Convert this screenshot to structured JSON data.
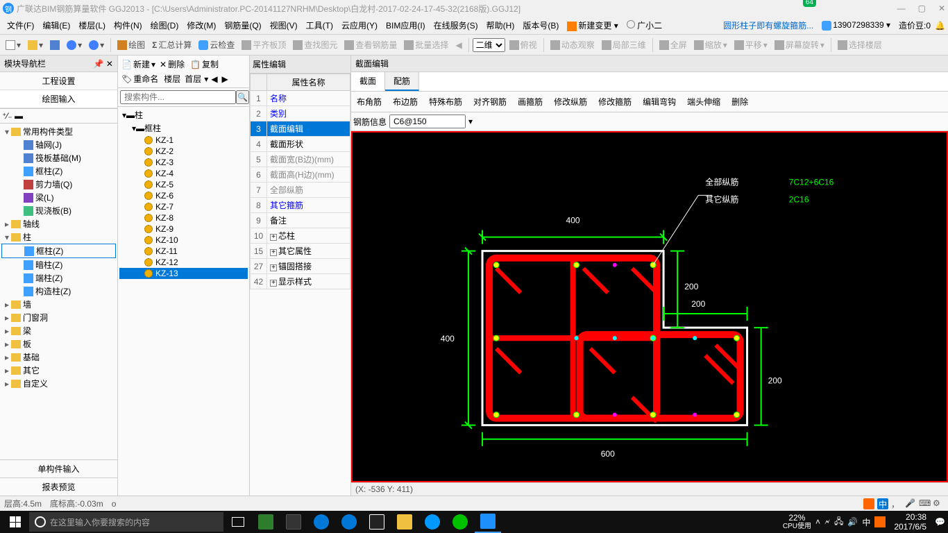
{
  "title": "广联达BIM钢筋算量软件 GGJ2013 - [C:\\Users\\Administrator.PC-20141127NRHM\\Desktop\\白龙村-2017-02-24-17-45-32(2168版).GGJ12]",
  "badge": "64",
  "menus": [
    "文件(F)",
    "编辑(E)",
    "楼层(L)",
    "构件(N)",
    "绘图(D)",
    "修改(M)",
    "钢筋量(Q)",
    "视图(V)",
    "工具(T)",
    "云应用(Y)",
    "BIM应用(I)",
    "在线服务(S)",
    "帮助(H)",
    "版本号(B)"
  ],
  "menu_right": {
    "new_change": "新建变更",
    "user": "广小二",
    "link": "圆形柱子即有螺旋箍筋...",
    "phone": "13907298339",
    "cost": "造价豆:0"
  },
  "toolbar": {
    "draw": "绘图",
    "sum": "汇总计算",
    "cloud": "云检查",
    "flat": "平齐板顶",
    "find": "查找图元",
    "steel": "查看钢筋量",
    "batch": "批量选择",
    "mode": "二维",
    "view": "俯视",
    "dyn": "动态观察",
    "local3d": "局部三维",
    "full": "全屏",
    "zoom": "缩放",
    "pan": "平移",
    "rot": "屏幕旋转",
    "floor": "选择楼层"
  },
  "left": {
    "title": "模块导航栏",
    "tab1": "工程设置",
    "tab2": "绘图输入",
    "groups": {
      "common": "常用构件类型",
      "grid": "轴网(J)",
      "raft": "筏板基础(M)",
      "fcol": "框柱(Z)",
      "shear": "剪力墙(Q)",
      "beam": "梁(L)",
      "slab": "现浇板(B)",
      "axis": "轴线",
      "col": "柱",
      "fcol2": "框柱(Z)",
      "dcol": "暗柱(Z)",
      "ecol": "端柱(Z)",
      "ccol": "构造柱(Z)",
      "wall": "墙",
      "door": "门窗洞",
      "beam2": "梁",
      "slab2": "板",
      "found": "基础",
      "other": "其它",
      "custom": "自定义"
    },
    "bottom1": "单构件输入",
    "bottom2": "报表预览"
  },
  "comp": {
    "toolbar": {
      "new": "新建",
      "del": "删除",
      "copy": "复制",
      "rename": "重命名",
      "floor": "楼层",
      "first": "首层"
    },
    "search_ph": "搜索构件...",
    "root": "柱",
    "group": "框柱",
    "items": [
      "KZ-1",
      "KZ-2",
      "KZ-3",
      "KZ-4",
      "KZ-5",
      "KZ-6",
      "KZ-7",
      "KZ-8",
      "KZ-9",
      "KZ-10",
      "KZ-11",
      "KZ-12",
      "KZ-13"
    ],
    "selected": "KZ-13"
  },
  "prop": {
    "title": "属性编辑",
    "header": "属性名称",
    "rows": [
      {
        "n": "1",
        "name": "名称",
        "cls": "blue"
      },
      {
        "n": "2",
        "name": "类别",
        "cls": "blue"
      },
      {
        "n": "3",
        "name": "截面编辑",
        "cls": "sel"
      },
      {
        "n": "4",
        "name": "截面形状",
        "cls": ""
      },
      {
        "n": "5",
        "name": "截面宽(B边)(mm)",
        "cls": "grey"
      },
      {
        "n": "6",
        "name": "截面高(H边)(mm)",
        "cls": "grey"
      },
      {
        "n": "7",
        "name": "全部纵筋",
        "cls": "grey"
      },
      {
        "n": "8",
        "name": "其它箍筋",
        "cls": "blue"
      },
      {
        "n": "9",
        "name": "备注",
        "cls": ""
      },
      {
        "n": "10",
        "name": "芯柱",
        "cls": "",
        "plus": true
      },
      {
        "n": "15",
        "name": "其它属性",
        "cls": "",
        "plus": true
      },
      {
        "n": "27",
        "name": "锚固搭接",
        "cls": "",
        "plus": true
      },
      {
        "n": "42",
        "name": "显示样式",
        "cls": "",
        "plus": true
      }
    ]
  },
  "section": {
    "title": "截面编辑",
    "tabs": [
      "截面",
      "配筋"
    ],
    "active_tab": 1,
    "tools": [
      "布角筋",
      "布边筋",
      "特殊布筋",
      "对齐钢筋",
      "画箍筋",
      "修改纵筋",
      "修改箍筋",
      "编辑弯钩",
      "端头伸缩",
      "删除"
    ],
    "rebar_label": "钢筋信息",
    "rebar_value": "C6@150",
    "labels": {
      "all": "全部纵筋",
      "other": "其它纵筋",
      "all_v": "7C12+6C16",
      "other_v": "2C16"
    },
    "dims": {
      "top": "400",
      "left": "400",
      "r1": "200",
      "r2": "200",
      "r3": "200",
      "bottom": "600"
    },
    "coord": "(X: -536 Y: 411)"
  },
  "status": {
    "floor": "层高:4.5m",
    "bottom": "底标高:-0.03m",
    "unit": "o"
  },
  "taskbar": {
    "search": "在这里输入你要搜索的内容",
    "cpu_pct": "22%",
    "cpu_lbl": "CPU使用",
    "time": "20:38",
    "date": "2017/6/5",
    "ime": "中"
  }
}
